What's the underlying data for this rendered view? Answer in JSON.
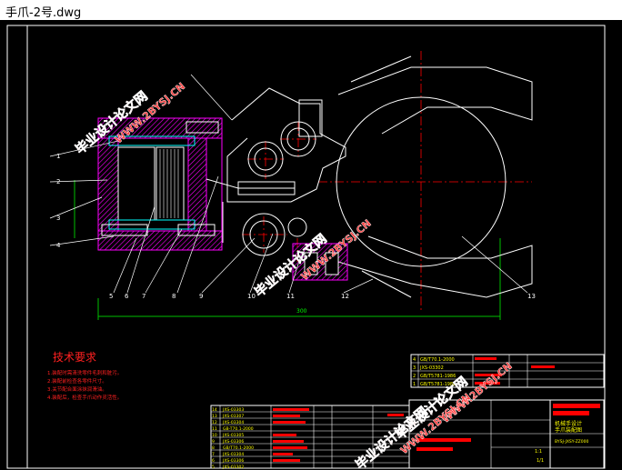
{
  "window": {
    "title": "手爪-2号.dwg"
  },
  "drawing": {
    "callouts": [
      "1",
      "2",
      "3",
      "4",
      "5",
      "6",
      "7",
      "8",
      "9",
      "10",
      "11",
      "12",
      "13"
    ],
    "dimension_text": "300",
    "tech_requirements": {
      "title": "技术要求",
      "items": [
        "1.装配时需清洗零件毛刺和脏污。",
        "2.装配前检查各零件尺寸。",
        "3.关节配合面涂抹润滑油。",
        "4.装配后，检查手爪动作灵活性。"
      ]
    },
    "parts_list_upper": [
      {
        "no": "4",
        "code": "GB/T70.1-2000"
      },
      {
        "no": "3",
        "code": "JXS-03302"
      },
      {
        "no": "2",
        "code": "GB/T5781-1986"
      },
      {
        "no": "1",
        "code": "GB/T5781-1986"
      }
    ],
    "parts_list_lower": [
      {
        "no": "14",
        "code": "JXS-03303"
      },
      {
        "no": "13",
        "code": "JXS-03307"
      },
      {
        "no": "12",
        "code": "JXS-03304"
      },
      {
        "no": "11",
        "code": "GB-T70.1-2000"
      },
      {
        "no": "10",
        "code": "JXS-03305"
      },
      {
        "no": "9",
        "code": "JXS-03306"
      },
      {
        "no": "8",
        "code": "GB/T70.1-2000"
      },
      {
        "no": "7",
        "code": "JXS-03304"
      },
      {
        "no": "6",
        "code": "JXS-03306"
      },
      {
        "no": "5",
        "code": "JXS-03302"
      }
    ],
    "title_block": {
      "name": "机械手设计",
      "subname": "手爪装配图",
      "drawing_no": "BYSJ-JXSY-ZZ000",
      "scale": "1:1",
      "sheet": "1/1"
    },
    "watermarks": [
      {
        "cn": "毕业设计论文网",
        "url": "WWW.2BYSJ.CN"
      },
      {
        "cn": "毕业设计论文网",
        "url": "WWW.2BYSJ.CN"
      },
      {
        "cn": "毕业设计论文网",
        "url": "WWW.2BYSJ.CN"
      },
      {
        "cn": "毕业设计论文网",
        "url": "WWW.2BYSJ.CN"
      }
    ]
  }
}
